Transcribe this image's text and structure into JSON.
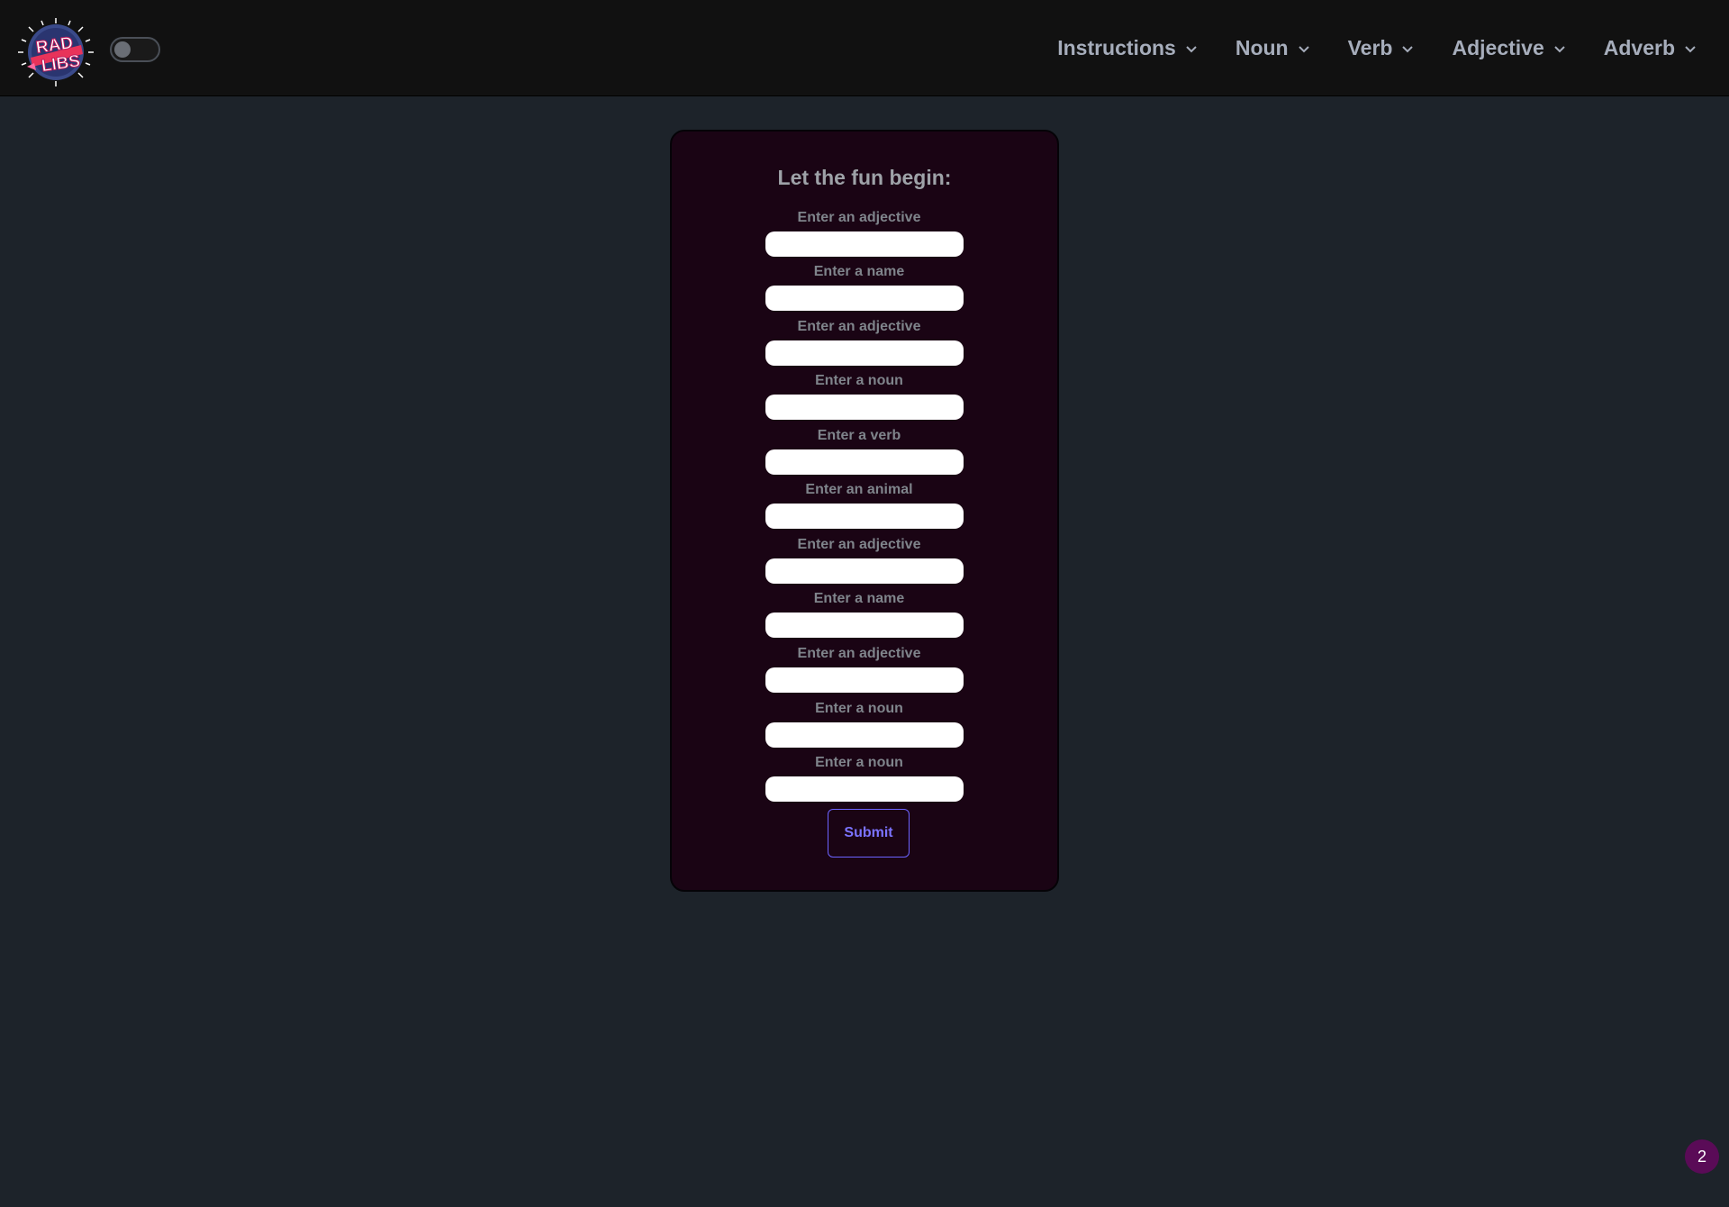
{
  "header": {
    "logo_text": "RAD LIBS",
    "theme_toggle": "off",
    "menu": [
      {
        "label": "Instructions",
        "icon": "chevron-down-icon"
      },
      {
        "label": "Noun",
        "icon": "chevron-down-icon"
      },
      {
        "label": "Verb",
        "icon": "chevron-down-icon"
      },
      {
        "label": "Adjective",
        "icon": "chevron-down-icon"
      },
      {
        "label": "Adverb",
        "icon": "chevron-down-icon"
      }
    ]
  },
  "form": {
    "title": "Let the fun begin:",
    "fields": [
      {
        "label": "Enter an adjective",
        "value": ""
      },
      {
        "label": "Enter a name",
        "value": ""
      },
      {
        "label": "Enter an adjective",
        "value": ""
      },
      {
        "label": "Enter a noun",
        "value": ""
      },
      {
        "label": "Enter a verb",
        "value": ""
      },
      {
        "label": "Enter an animal",
        "value": ""
      },
      {
        "label": "Enter an adjective",
        "value": ""
      },
      {
        "label": "Enter a name",
        "value": ""
      },
      {
        "label": "Enter an adjective",
        "value": ""
      },
      {
        "label": "Enter a noun",
        "value": ""
      },
      {
        "label": "Enter a noun",
        "value": ""
      }
    ],
    "submit_label": "Submit"
  },
  "badge": {
    "count": "2"
  },
  "colors": {
    "background": "#1d232a",
    "navbar": "#111111",
    "card": "#1a0414",
    "submit_accent": "#6c63ff",
    "badge": "#5a0b57"
  }
}
